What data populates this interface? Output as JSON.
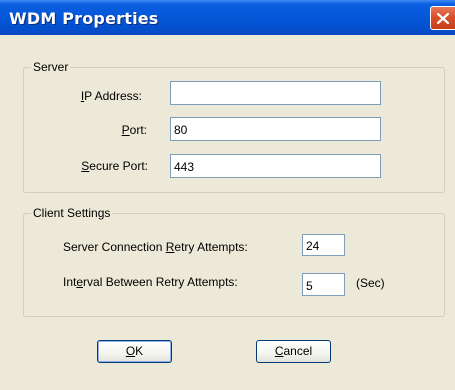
{
  "window": {
    "title": "WDM Properties"
  },
  "server": {
    "legend": "Server",
    "ip_label_first": "I",
    "ip_label_rest": "P Address:",
    "ip_value": "",
    "port_label_first": "P",
    "port_label_rest": "ort:",
    "port_value": "80",
    "secure_label_first": "S",
    "secure_label_rest": "ecure Port:",
    "secure_value": "443"
  },
  "client": {
    "legend": "Client Settings",
    "retry_label_pre": "Server Connection ",
    "retry_label_ul": "R",
    "retry_label_post": "etry Attempts:",
    "retry_value": "24",
    "interval_label_pre": "Int",
    "interval_label_ul": "e",
    "interval_label_post": "rval Between Retry Attempts:",
    "interval_value": "5",
    "interval_unit": "(Sec)"
  },
  "buttons": {
    "ok_ul": "O",
    "ok_rest": "K",
    "cancel_ul": "C",
    "cancel_rest": "ancel"
  },
  "colors": {
    "title_bar": "#0457d8",
    "close": "#d8502c",
    "dialog_bg": "#ece9d8"
  }
}
